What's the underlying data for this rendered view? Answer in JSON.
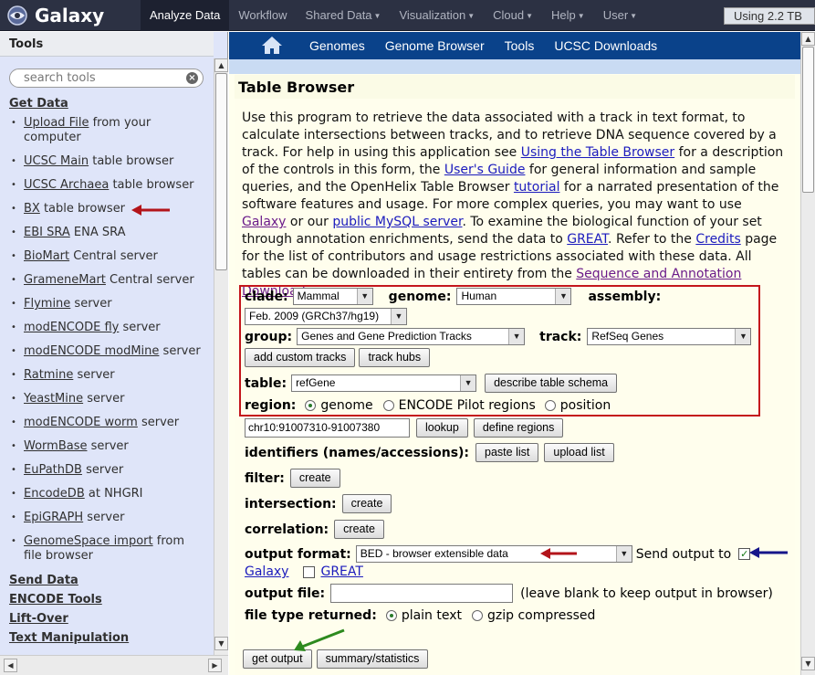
{
  "masthead": {
    "brand": "Galaxy",
    "tabs": [
      {
        "label": "Analyze Data",
        "dropdown": false,
        "active": true
      },
      {
        "label": "Workflow",
        "dropdown": false,
        "active": false
      },
      {
        "label": "Shared Data",
        "dropdown": true,
        "active": false
      },
      {
        "label": "Visualization",
        "dropdown": true,
        "active": false
      },
      {
        "label": "Cloud",
        "dropdown": true,
        "active": false
      },
      {
        "label": "Help",
        "dropdown": true,
        "active": false
      },
      {
        "label": "User",
        "dropdown": true,
        "active": false
      }
    ],
    "quota": "Using 2.2 TB"
  },
  "tools": {
    "header": "Tools",
    "search_placeholder": "search tools",
    "sections": {
      "get_data": "Get Data",
      "send_data": "Send Data",
      "encode_tools": "ENCODE Tools",
      "lift_over": "Lift-Over",
      "text_manipulation": "Text Manipulation"
    },
    "items": [
      {
        "link": "Upload File",
        "text": " from your computer"
      },
      {
        "link": "UCSC Main",
        "text": " table browser"
      },
      {
        "link": "UCSC Archaea",
        "text": " table browser"
      },
      {
        "link": "BX",
        "text": " table browser"
      },
      {
        "link": "EBI SRA",
        "text": " ENA SRA"
      },
      {
        "link": "BioMart",
        "text": " Central server"
      },
      {
        "link": "GrameneMart",
        "text": " Central server"
      },
      {
        "link": "Flymine",
        "text": " server"
      },
      {
        "link": "modENCODE fly",
        "text": " server"
      },
      {
        "link": "modENCODE modMine",
        "text": " server"
      },
      {
        "link": "Ratmine",
        "text": " server"
      },
      {
        "link": "YeastMine",
        "text": " server"
      },
      {
        "link": "modENCODE worm",
        "text": " server"
      },
      {
        "link": "WormBase",
        "text": " server"
      },
      {
        "link": "EuPathDB",
        "text": " server"
      },
      {
        "link": "EncodeDB",
        "text": " at NHGRI"
      },
      {
        "link": "EpiGRAPH",
        "text": " server"
      },
      {
        "link": "GenomeSpace import",
        "text": " from file browser"
      }
    ]
  },
  "ucsc_nav": {
    "items": [
      "Genomes",
      "Genome Browser",
      "Tools",
      "UCSC Downloads"
    ]
  },
  "table_browser": {
    "title": "Table Browser",
    "intro": {
      "p1": "Use this program to retrieve the data associated with a track in text format, to calculate intersections between tracks, and to retrieve DNA sequence covered by a track. For help in using this application see ",
      "link1": "Using the Table Browser",
      "p2": " for a description of the controls in this form, the ",
      "link2": "User's Guide",
      "p3": " for general information and sample queries, and the OpenHelix Table Browser ",
      "link3": "tutorial",
      "p4": " for a narrated presentation of the software features and usage. For more complex queries, you may want to use ",
      "link4": "Galaxy",
      "p5": " or our ",
      "link5": "public MySQL server",
      "p6": ". To examine the biological function of your set through annotation enrichments, send the data to ",
      "link6": "GREAT",
      "p7": ". Refer to the ",
      "link7": "Credits",
      "p8": " page for the list of contributors and usage restrictions associated with these data. All tables can be downloaded in their entirety from the ",
      "link8": "Sequence and Annotation Downloads",
      "p9": " page."
    },
    "form": {
      "clade_label": "clade:",
      "clade_value": "Mammal",
      "genome_label": "genome:",
      "genome_value": "Human",
      "assembly_label": "assembly:",
      "assembly_value": "Feb. 2009 (GRCh37/hg19)",
      "group_label": "group:",
      "group_value": "Genes and Gene Prediction Tracks",
      "track_label": "track:",
      "track_value": "RefSeq Genes",
      "add_custom_tracks": "add custom tracks",
      "track_hubs": "track hubs",
      "table_label": "table:",
      "table_value": "refGene",
      "describe_schema": "describe table schema",
      "region_label": "region:",
      "region_genome": "genome",
      "region_encode": "ENCODE Pilot regions",
      "region_position": "position",
      "position_value": "chr10:91007310-91007380",
      "lookup": "lookup",
      "define_regions": "define regions",
      "identifiers_label": "identifiers (names/accessions):",
      "paste_list": "paste list",
      "upload_list": "upload list",
      "filter_label": "filter:",
      "intersection_label": "intersection:",
      "correlation_label": "correlation:",
      "create": "create",
      "output_format_label": "output format:",
      "output_format_value": "BED - browser extensible data",
      "send_output_to": "Send output to",
      "send_galaxy": "Galaxy",
      "send_great": "GREAT",
      "output_file_label": "output file:",
      "output_file_value": "",
      "output_file_hint": "(leave blank to keep output in browser)",
      "file_type_label": "file type returned:",
      "file_type_plain": "plain text",
      "file_type_gzip": "gzip compressed",
      "get_output": "get output",
      "summary_statistics": "summary/statistics"
    }
  },
  "colors": {
    "masthead": "#2c3143",
    "tool_panel": "#dfe5f9",
    "ucsc_nav": "#0a428a",
    "frame_bg": "#fffeed",
    "red_highlight": "#c4161c",
    "annotation_red": "#b3141a",
    "annotation_blue": "#16168a",
    "annotation_green": "#2d8a1e"
  }
}
